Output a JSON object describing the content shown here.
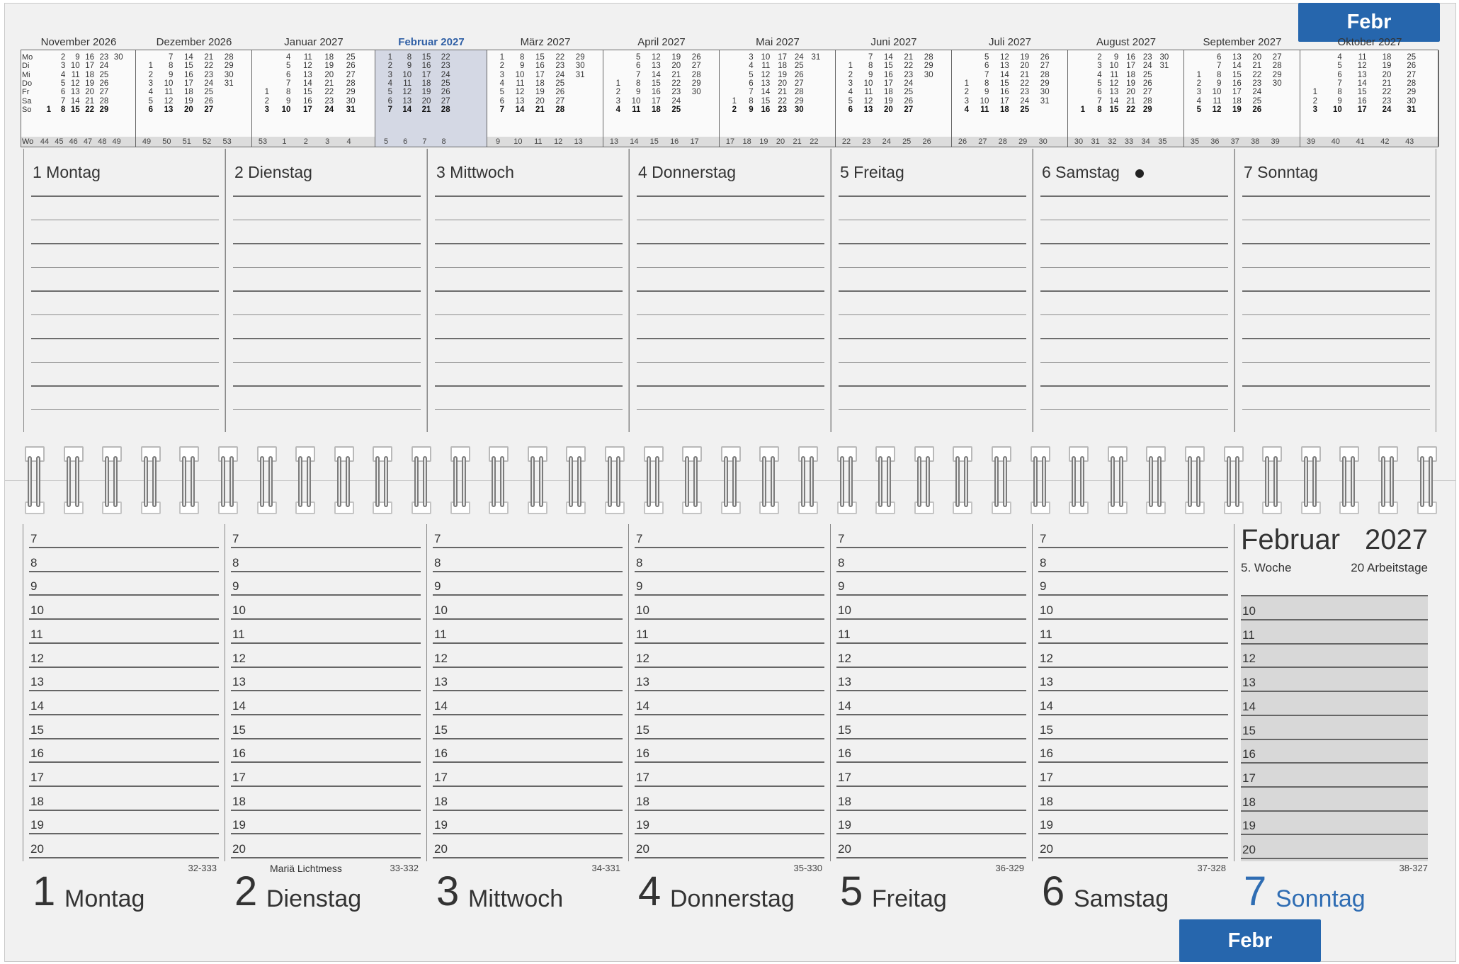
{
  "tabs": {
    "top": "Febr",
    "bottom": "Febr"
  },
  "weekday_abbr": [
    "Mo",
    "Di",
    "Mi",
    "Do",
    "Fr",
    "Sa",
    "So",
    "Wo"
  ],
  "months": [
    {
      "name": "November 2026",
      "days": [
        [
          "",
          "2",
          "9",
          "16",
          "23",
          "30"
        ],
        [
          "",
          "3",
          "10",
          "17",
          "24",
          ""
        ],
        [
          "",
          "4",
          "11",
          "18",
          "25",
          ""
        ],
        [
          "",
          "5",
          "12",
          "19",
          "26",
          ""
        ],
        [
          "",
          "6",
          "13",
          "20",
          "27",
          ""
        ],
        [
          "",
          "7",
          "14",
          "21",
          "28",
          ""
        ],
        [
          "1",
          "8",
          "15",
          "22",
          "29",
          ""
        ]
      ],
      "bold": [
        "1",
        "8",
        "15",
        "22",
        "29"
      ],
      "weeks": [
        "44",
        "45",
        "46",
        "47",
        "48",
        "49"
      ]
    },
    {
      "name": "Dezember 2026",
      "days": [
        [
          "",
          "7",
          "14",
          "21",
          "28"
        ],
        [
          "1",
          "8",
          "15",
          "22",
          "29"
        ],
        [
          "2",
          "9",
          "16",
          "23",
          "30"
        ],
        [
          "3",
          "10",
          "17",
          "24",
          "31"
        ],
        [
          "4",
          "11",
          "18",
          "25",
          ""
        ],
        [
          "5",
          "12",
          "19",
          "26",
          ""
        ],
        [
          "6",
          "13",
          "20",
          "27",
          ""
        ]
      ],
      "bold": [
        "25",
        "26",
        "6",
        "13",
        "20",
        "27"
      ],
      "weeks": [
        "49",
        "50",
        "51",
        "52",
        "53"
      ]
    },
    {
      "name": "Januar 2027",
      "days": [
        [
          "",
          "4",
          "11",
          "18",
          "25"
        ],
        [
          "",
          "5",
          "12",
          "19",
          "26"
        ],
        [
          "",
          "6",
          "13",
          "20",
          "27"
        ],
        [
          "",
          "7",
          "14",
          "21",
          "28"
        ],
        [
          "1",
          "8",
          "15",
          "22",
          "29"
        ],
        [
          "2",
          "9",
          "16",
          "23",
          "30"
        ],
        [
          "3",
          "10",
          "17",
          "24",
          "31"
        ]
      ],
      "bold": [
        "1",
        "3",
        "10",
        "17",
        "24",
        "31"
      ],
      "weeks": [
        "53",
        "1",
        "2",
        "3",
        "4"
      ]
    },
    {
      "name": "Februar 2027",
      "days": [
        [
          "1",
          "8",
          "15",
          "22"
        ],
        [
          "2",
          "9",
          "16",
          "23"
        ],
        [
          "3",
          "10",
          "17",
          "24"
        ],
        [
          "4",
          "11",
          "18",
          "25"
        ],
        [
          "5",
          "12",
          "19",
          "26"
        ],
        [
          "6",
          "13",
          "20",
          "27"
        ],
        [
          "7",
          "14",
          "21",
          "28"
        ]
      ],
      "bold": [
        "7",
        "14",
        "21",
        "28"
      ],
      "weeks": [
        "5",
        "6",
        "7",
        "8"
      ],
      "current": true
    },
    {
      "name": "März 2027",
      "days": [
        [
          "1",
          "8",
          "15",
          "22",
          "29"
        ],
        [
          "2",
          "9",
          "16",
          "23",
          "30"
        ],
        [
          "3",
          "10",
          "17",
          "24",
          "31"
        ],
        [
          "4",
          "11",
          "18",
          "25",
          ""
        ],
        [
          "5",
          "12",
          "19",
          "26",
          ""
        ],
        [
          "6",
          "13",
          "20",
          "27",
          ""
        ],
        [
          "7",
          "14",
          "21",
          "28",
          ""
        ]
      ],
      "bold": [
        "29",
        "26",
        "7",
        "14",
        "21",
        "28"
      ],
      "weeks": [
        "9",
        "10",
        "11",
        "12",
        "13"
      ]
    },
    {
      "name": "April 2027",
      "days": [
        [
          "",
          "5",
          "12",
          "19",
          "26"
        ],
        [
          "",
          "6",
          "13",
          "20",
          "27"
        ],
        [
          "",
          "7",
          "14",
          "21",
          "28"
        ],
        [
          "1",
          "8",
          "15",
          "22",
          "29"
        ],
        [
          "2",
          "9",
          "16",
          "23",
          "30"
        ],
        [
          "3",
          "10",
          "17",
          "24",
          ""
        ],
        [
          "4",
          "11",
          "18",
          "25",
          ""
        ]
      ],
      "bold": [
        "4",
        "11",
        "18",
        "25"
      ],
      "weeks": [
        "13",
        "14",
        "15",
        "16",
        "17"
      ]
    },
    {
      "name": "Mai 2027",
      "days": [
        [
          "",
          "3",
          "10",
          "17",
          "24",
          "31"
        ],
        [
          "",
          "4",
          "11",
          "18",
          "25",
          ""
        ],
        [
          "",
          "5",
          "12",
          "19",
          "26",
          ""
        ],
        [
          "",
          "6",
          "13",
          "20",
          "27",
          ""
        ],
        [
          "",
          "7",
          "14",
          "21",
          "28",
          ""
        ],
        [
          "1",
          "8",
          "15",
          "22",
          "29",
          ""
        ],
        [
          "2",
          "9",
          "16",
          "23",
          "30",
          ""
        ]
      ],
      "bold": [
        "17",
        "6",
        "2",
        "9",
        "16",
        "23",
        "30"
      ],
      "weeks": [
        "17",
        "18",
        "19",
        "20",
        "21",
        "22"
      ]
    },
    {
      "name": "Juni 2027",
      "days": [
        [
          "",
          "7",
          "14",
          "21",
          "28"
        ],
        [
          "1",
          "8",
          "15",
          "22",
          "29"
        ],
        [
          "2",
          "9",
          "16",
          "23",
          "30"
        ],
        [
          "3",
          "10",
          "17",
          "24",
          ""
        ],
        [
          "4",
          "11",
          "18",
          "25",
          ""
        ],
        [
          "5",
          "12",
          "19",
          "26",
          ""
        ],
        [
          "6",
          "13",
          "20",
          "27",
          ""
        ]
      ],
      "bold": [
        "6",
        "13",
        "20",
        "27"
      ],
      "weeks": [
        "22",
        "23",
        "24",
        "25",
        "26"
      ]
    },
    {
      "name": "Juli 2027",
      "days": [
        [
          "",
          "5",
          "12",
          "19",
          "26"
        ],
        [
          "",
          "6",
          "13",
          "20",
          "27"
        ],
        [
          "",
          "7",
          "14",
          "21",
          "28"
        ],
        [
          "1",
          "8",
          "15",
          "22",
          "29"
        ],
        [
          "2",
          "9",
          "16",
          "23",
          "30"
        ],
        [
          "3",
          "10",
          "17",
          "24",
          "31"
        ],
        [
          "4",
          "11",
          "18",
          "25",
          ""
        ]
      ],
      "bold": [
        "4",
        "11",
        "18",
        "25"
      ],
      "weeks": [
        "26",
        "27",
        "28",
        "29",
        "30"
      ]
    },
    {
      "name": "August 2027",
      "days": [
        [
          "",
          "2",
          "9",
          "16",
          "23",
          "30"
        ],
        [
          "",
          "3",
          "10",
          "17",
          "24",
          "31"
        ],
        [
          "",
          "4",
          "11",
          "18",
          "25",
          ""
        ],
        [
          "",
          "5",
          "12",
          "19",
          "26",
          ""
        ],
        [
          "",
          "6",
          "13",
          "20",
          "27",
          ""
        ],
        [
          "",
          "7",
          "14",
          "21",
          "28",
          ""
        ],
        [
          "1",
          "8",
          "15",
          "22",
          "29",
          ""
        ]
      ],
      "bold": [
        "1",
        "8",
        "15",
        "22",
        "29"
      ],
      "weeks": [
        "30",
        "31",
        "32",
        "33",
        "34",
        "35"
      ]
    },
    {
      "name": "September 2027",
      "days": [
        [
          "",
          "6",
          "13",
          "20",
          "27"
        ],
        [
          "",
          "7",
          "14",
          "21",
          "28"
        ],
        [
          "1",
          "8",
          "15",
          "22",
          "29"
        ],
        [
          "2",
          "9",
          "16",
          "23",
          "30"
        ],
        [
          "3",
          "10",
          "17",
          "24",
          ""
        ],
        [
          "4",
          "11",
          "18",
          "25",
          ""
        ],
        [
          "5",
          "12",
          "19",
          "26",
          ""
        ]
      ],
      "bold": [
        "5",
        "12",
        "19",
        "26"
      ],
      "weeks": [
        "35",
        "36",
        "37",
        "38",
        "39"
      ]
    },
    {
      "name": "Oktober 2027",
      "days": [
        [
          "",
          "4",
          "11",
          "18",
          "25"
        ],
        [
          "",
          "5",
          "12",
          "19",
          "26"
        ],
        [
          "",
          "6",
          "13",
          "20",
          "27"
        ],
        [
          "",
          "7",
          "14",
          "21",
          "28"
        ],
        [
          "1",
          "8",
          "15",
          "22",
          "29"
        ],
        [
          "2",
          "9",
          "16",
          "23",
          "30"
        ],
        [
          "3",
          "10",
          "17",
          "24",
          "31"
        ]
      ],
      "bold": [
        "3",
        "10",
        "17",
        "24",
        "31"
      ],
      "weeks": [
        "39",
        "40",
        "41",
        "42",
        "43"
      ]
    }
  ],
  "top_days": [
    "1 Montag",
    "2 Dienstag",
    "3 Mittwoch",
    "4 Donnerstag",
    "5 Freitag",
    "6 Samstag",
    "7 Sonntag"
  ],
  "hours": [
    "7",
    "8",
    "9",
    "10",
    "11",
    "12",
    "13",
    "14",
    "15",
    "16",
    "17",
    "18",
    "19",
    "20"
  ],
  "bottom_days": [
    {
      "num": "1",
      "name": "Montag",
      "code": "32-333",
      "holiday": ""
    },
    {
      "num": "2",
      "name": "Dienstag",
      "code": "33-332",
      "holiday": "Mariä Lichtmess"
    },
    {
      "num": "3",
      "name": "Mittwoch",
      "code": "34-331",
      "holiday": ""
    },
    {
      "num": "4",
      "name": "Donnerstag",
      "code": "35-330",
      "holiday": ""
    },
    {
      "num": "5",
      "name": "Freitag",
      "code": "36-329",
      "holiday": ""
    },
    {
      "num": "6",
      "name": "Samstag",
      "code": "37-328",
      "holiday": ""
    },
    {
      "num": "7",
      "name": "Sonntag",
      "code": "38-327",
      "holiday": ""
    }
  ],
  "sunday_box": {
    "month": "Februar",
    "year": "2027",
    "week": "5. Woche",
    "workdays": "20 Arbeitstage",
    "hours": [
      "10",
      "11",
      "12",
      "13",
      "14",
      "15",
      "16",
      "17",
      "18",
      "19",
      "20"
    ]
  },
  "colors": {
    "accent": "#2666ad",
    "sunday": "#2f6db3"
  }
}
